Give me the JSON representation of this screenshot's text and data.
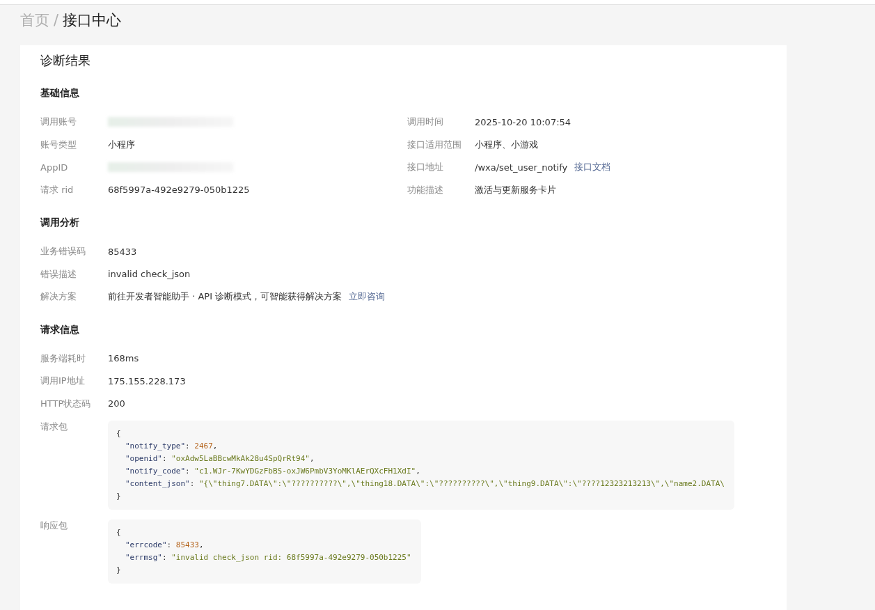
{
  "breadcrumb": [
    {
      "label": "首页",
      "kind": "link"
    },
    {
      "label": "/",
      "kind": "separator"
    },
    {
      "label": "接口中心",
      "kind": "current"
    }
  ],
  "card": {
    "title": "诊断结果",
    "sections": [
      {
        "title": "基础信息",
        "columns": [
          [
            {
              "label": "调用账号",
              "kind": "redacted"
            },
            {
              "label": "账号类型",
              "kind": "text",
              "value": "小程序"
            },
            {
              "label": "AppID",
              "kind": "redacted"
            },
            {
              "label": "请求 rid",
              "kind": "text",
              "value": "68f5997a-492e9279-050b1225"
            }
          ],
          [
            {
              "label": "调用时间",
              "kind": "text",
              "value": "2025-10-20 10:07:54"
            },
            {
              "label": "接口适用范围",
              "kind": "text",
              "value": "小程序、小游戏"
            },
            {
              "label": "接口地址",
              "kind": "text",
              "value": "/wxa/set_user_notify",
              "link": "接口文档"
            },
            {
              "label": "功能描述",
              "kind": "text",
              "value": "激活与更新服务卡片"
            }
          ]
        ]
      },
      {
        "title": "调用分析",
        "columns": [
          [
            {
              "label": "业务错误码",
              "kind": "text",
              "value": "85433"
            },
            {
              "label": "错误描述",
              "kind": "text",
              "value": "invalid check_json"
            },
            {
              "label": "解决方案",
              "kind": "text",
              "value": "前往开发者智能助手 · API 诊断模式，可智能获得解决方案",
              "link": "立即咨询"
            }
          ]
        ]
      },
      {
        "title": "请求信息",
        "columns": [
          [
            {
              "label": "服务端耗时",
              "kind": "text",
              "value": "168ms"
            },
            {
              "label": "调用IP地址",
              "kind": "text",
              "value": "175.155.228.173"
            },
            {
              "label": "HTTP状态码",
              "kind": "text",
              "value": "200"
            },
            {
              "label": "请求包",
              "kind": "code",
              "lines": [
                {
                  "indented": false,
                  "tokens": [
                    {
                      "kind": "punct",
                      "text": "{"
                    }
                  ]
                },
                {
                  "indented": true,
                  "tokens": [
                    {
                      "kind": "key",
                      "text": "\"notify_type\""
                    },
                    {
                      "kind": "punct",
                      "text": ": "
                    },
                    {
                      "kind": "number",
                      "text": "2467"
                    },
                    {
                      "kind": "punct",
                      "text": ","
                    }
                  ]
                },
                {
                  "indented": true,
                  "tokens": [
                    {
                      "kind": "key",
                      "text": "\"openid\""
                    },
                    {
                      "kind": "punct",
                      "text": ": "
                    },
                    {
                      "kind": "string",
                      "text": "\"oxAdw5LaBBcwMkAk28u4SpQrRt94\""
                    },
                    {
                      "kind": "punct",
                      "text": ","
                    }
                  ]
                },
                {
                  "indented": true,
                  "tokens": [
                    {
                      "kind": "key",
                      "text": "\"notify_code\""
                    },
                    {
                      "kind": "punct",
                      "text": ": "
                    },
                    {
                      "kind": "string",
                      "text": "\"c1.WJr-7KwYDGzFbBS-oxJW6PmbV3YoMKlAErQXcFH1XdI\""
                    },
                    {
                      "kind": "punct",
                      "text": ","
                    }
                  ]
                },
                {
                  "indented": true,
                  "tokens": [
                    {
                      "kind": "key",
                      "text": "\"content_json\""
                    },
                    {
                      "kind": "punct",
                      "text": ": "
                    },
                    {
                      "kind": "string",
                      "text": "\"{\\\"thing7.DATA\\\":\\\"??????????\\\",\\\"thing18.DATA\\\":\\\"??????????\\\",\\\"thing9.DATA\\\":\\\"????12323213213\\\",\\\"name2.DATA\\"
                    }
                  ]
                },
                {
                  "indented": false,
                  "tokens": [
                    {
                      "kind": "punct",
                      "text": "}"
                    }
                  ]
                }
              ]
            },
            {
              "label": "响应包",
              "kind": "code",
              "lines": [
                {
                  "indented": false,
                  "tokens": [
                    {
                      "kind": "punct",
                      "text": "{"
                    }
                  ]
                },
                {
                  "indented": true,
                  "tokens": [
                    {
                      "kind": "key",
                      "text": "\"errcode\""
                    },
                    {
                      "kind": "punct",
                      "text": ": "
                    },
                    {
                      "kind": "number",
                      "text": "85433"
                    },
                    {
                      "kind": "punct",
                      "text": ","
                    }
                  ]
                },
                {
                  "indented": true,
                  "tokens": [
                    {
                      "kind": "key",
                      "text": "\"errmsg\""
                    },
                    {
                      "kind": "punct",
                      "text": ": "
                    },
                    {
                      "kind": "string",
                      "text": "\"invalid check_json rid: 68f5997a-492e9279-050b1225\""
                    }
                  ]
                },
                {
                  "indented": false,
                  "tokens": [
                    {
                      "kind": "punct",
                      "text": "}"
                    }
                  ]
                }
              ]
            }
          ]
        ]
      }
    ]
  }
}
